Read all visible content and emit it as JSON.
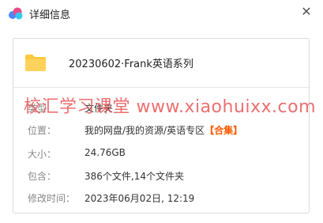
{
  "window": {
    "title": "详细信息",
    "close_glyph": "✕"
  },
  "file": {
    "name": "20230602·Frank英语系列"
  },
  "info": {
    "type": {
      "label": "类型",
      "value": "文件夹"
    },
    "location": {
      "label": "位置：",
      "value": "我的网盘/我的资源/英语专区",
      "tag": "【合集】"
    },
    "size": {
      "label": "大小：",
      "value": "24.76GB"
    },
    "contains": {
      "label": "包含：",
      "value": "386个文件,14个文件夹"
    },
    "modified": {
      "label": "修改时间：",
      "value": "2023年06月02日, 12:19"
    }
  },
  "watermark": "校汇学习课堂 www.xiaohuixx.com",
  "colors": {
    "folder": "#ffd35b",
    "accent": "#ff5a00",
    "watermark": "#e85050"
  },
  "icons": {
    "app": "cloud-logo-icon",
    "folder": "folder-icon",
    "close": "close-icon"
  }
}
